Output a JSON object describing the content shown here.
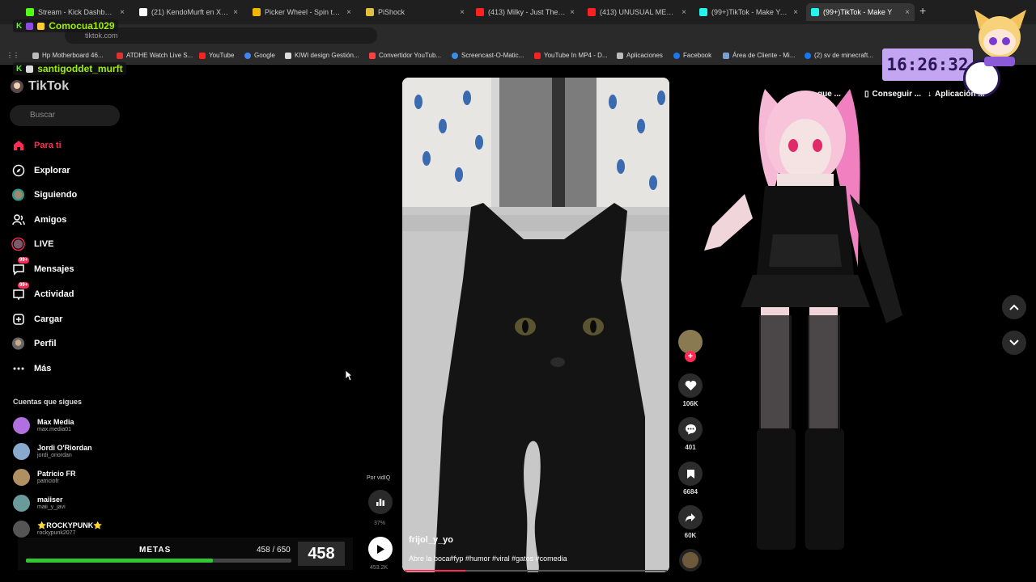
{
  "browser": {
    "tabs": [
      {
        "title": "Stream - Kick Dashboard",
        "fav": "#53fc18"
      },
      {
        "title": "(21) KendoMurft en X: \"Ca",
        "fav": "#ffffff"
      },
      {
        "title": "Picker Wheel - Spin the W",
        "fav": "#f2b705"
      },
      {
        "title": "PiShock",
        "fav": "#e0c040"
      },
      {
        "title": "(413) Milky - Just The Wa",
        "fav": "#ff2020"
      },
      {
        "title": "(413) UNUSUAL MEMES C",
        "fav": "#ff2020"
      },
      {
        "title": "(99+)TikTok - Make Your",
        "fav": "#25f4ee"
      },
      {
        "title": "(99+)TikTok - Make Y",
        "fav": "#25f4ee"
      }
    ],
    "new_tab": "+",
    "close": "×",
    "url": "tiktok.com",
    "bookmarks": [
      {
        "label": "Hp Motherboard 46...",
        "fav": "#bbbbbb"
      },
      {
        "label": "ATDHE Watch Live S...",
        "fav": "#e03030"
      },
      {
        "label": "YouTube",
        "fav": "#ff2020"
      },
      {
        "label": "Google",
        "fav": "#4285f4"
      },
      {
        "label": "KIWI design Gestión...",
        "fav": "#dddddd"
      },
      {
        "label": "Convertidor YouTub...",
        "fav": "#ff4040"
      },
      {
        "label": "Screencast-O-Matic...",
        "fav": "#3a8ee6"
      },
      {
        "label": "YouTube In MP4 - D...",
        "fav": "#ff2020"
      },
      {
        "label": "Aplicaciones",
        "fav": "#bbbbbb"
      },
      {
        "label": "Facebook",
        "fav": "#1877f2"
      },
      {
        "label": "Área de Cliente - Mi...",
        "fav": "#7aa0d0"
      },
      {
        "label": "(2) sv de minecraft...",
        "fav": "#1877f2"
      }
    ]
  },
  "stream": {
    "chat_users": [
      "Comocua1029",
      "santigoddet_murft"
    ],
    "clock": "16:26:32",
    "goal": {
      "label": "METAS",
      "count": "458 / 650",
      "current": "458",
      "progress": 0.705
    }
  },
  "tiktok": {
    "logo": "TikTok",
    "search_placeholder": "Buscar",
    "nav": [
      {
        "label": "Para ti",
        "icon": "home"
      },
      {
        "label": "Explorar",
        "icon": "compass"
      },
      {
        "label": "Siguiendo",
        "icon": "avatar"
      },
      {
        "label": "Amigos",
        "icon": "friends"
      },
      {
        "label": "LIVE",
        "icon": "live"
      },
      {
        "label": "Mensajes",
        "icon": "messages",
        "badge": "99+"
      },
      {
        "label": "Actividad",
        "icon": "activity",
        "badge": "99+"
      },
      {
        "label": "Cargar",
        "icon": "upload"
      },
      {
        "label": "Perfil",
        "icon": "profile"
      },
      {
        "label": "Más",
        "icon": "more"
      }
    ],
    "following_header": "Cuentas que sigues",
    "accounts": [
      {
        "name": "Max Media",
        "handle": "max.media01",
        "color": "#b070e0"
      },
      {
        "name": "Jordi O'Riordan",
        "handle": "jordi_oriordan",
        "color": "#88aacc"
      },
      {
        "name": "Patricio FR",
        "handle": "patriciofr",
        "color": "#b09060"
      },
      {
        "name": "maiiser",
        "handle": "maii_y_javi",
        "color": "#6a9a9a"
      },
      {
        "name": "⭐ROCKYPUNK⭐",
        "handle": "rockypunk2077",
        "color": "#555555"
      }
    ],
    "video": {
      "author": "frijol_y_yo",
      "caption": "Abre la boca#fyp #humor #viral #gatos #comedia",
      "progress": 0.23
    },
    "actions": {
      "likes": "106K",
      "comments": "401",
      "saves": "6684",
      "shares": "60K"
    },
    "vidiq": {
      "label": "Por vidIQ",
      "percent": "37%",
      "plays": "453.2K"
    },
    "top_buttons": [
      "gue ...",
      "Conseguir ...",
      "Aplicación ..."
    ]
  }
}
